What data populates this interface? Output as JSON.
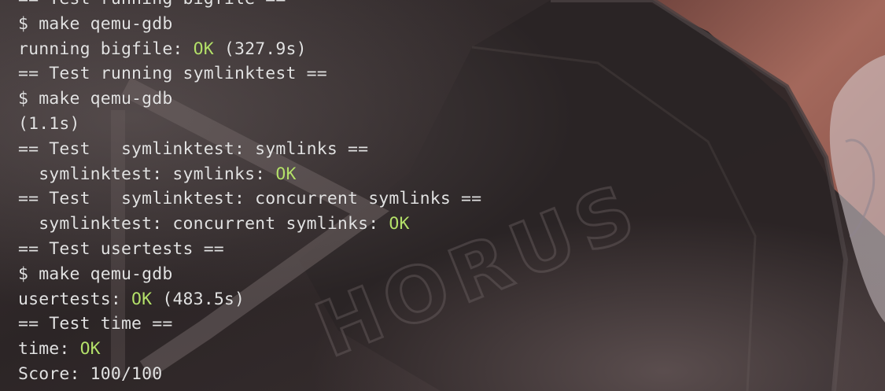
{
  "colors": {
    "text": "#e2e2e2",
    "ok": "#b4e06a",
    "background": "#2e2627",
    "accent_warm": "#b87465"
  },
  "wallpaper": {
    "watermark_text": "HORUS"
  },
  "terminal": {
    "lines": [
      {
        "parts": [
          {
            "text": "== Test running bigfile =="
          }
        ]
      },
      {
        "parts": [
          {
            "text": "$ make qemu-gdb"
          }
        ]
      },
      {
        "parts": [
          {
            "text": "running bigfile: "
          },
          {
            "text": "OK",
            "status": "ok"
          },
          {
            "text": " (327.9s)"
          }
        ]
      },
      {
        "parts": [
          {
            "text": "== Test running symlinktest =="
          }
        ]
      },
      {
        "parts": [
          {
            "text": "$ make qemu-gdb"
          }
        ]
      },
      {
        "parts": [
          {
            "text": "(1.1s)"
          }
        ]
      },
      {
        "parts": [
          {
            "text": "== Test   symlinktest: symlinks =="
          }
        ]
      },
      {
        "parts": [
          {
            "text": "  symlinktest: symlinks: "
          },
          {
            "text": "OK",
            "status": "ok"
          }
        ]
      },
      {
        "parts": [
          {
            "text": "== Test   symlinktest: concurrent symlinks =="
          }
        ]
      },
      {
        "parts": [
          {
            "text": "  symlinktest: concurrent symlinks: "
          },
          {
            "text": "OK",
            "status": "ok"
          }
        ]
      },
      {
        "parts": [
          {
            "text": "== Test usertests =="
          }
        ]
      },
      {
        "parts": [
          {
            "text": "$ make qemu-gdb"
          }
        ]
      },
      {
        "parts": [
          {
            "text": "usertests: "
          },
          {
            "text": "OK",
            "status": "ok"
          },
          {
            "text": " (483.5s)"
          }
        ]
      },
      {
        "parts": [
          {
            "text": "== Test time =="
          }
        ]
      },
      {
        "parts": [
          {
            "text": "time: "
          },
          {
            "text": "OK",
            "status": "ok"
          }
        ]
      },
      {
        "parts": [
          {
            "text": "Score: 100/100"
          }
        ]
      }
    ]
  }
}
